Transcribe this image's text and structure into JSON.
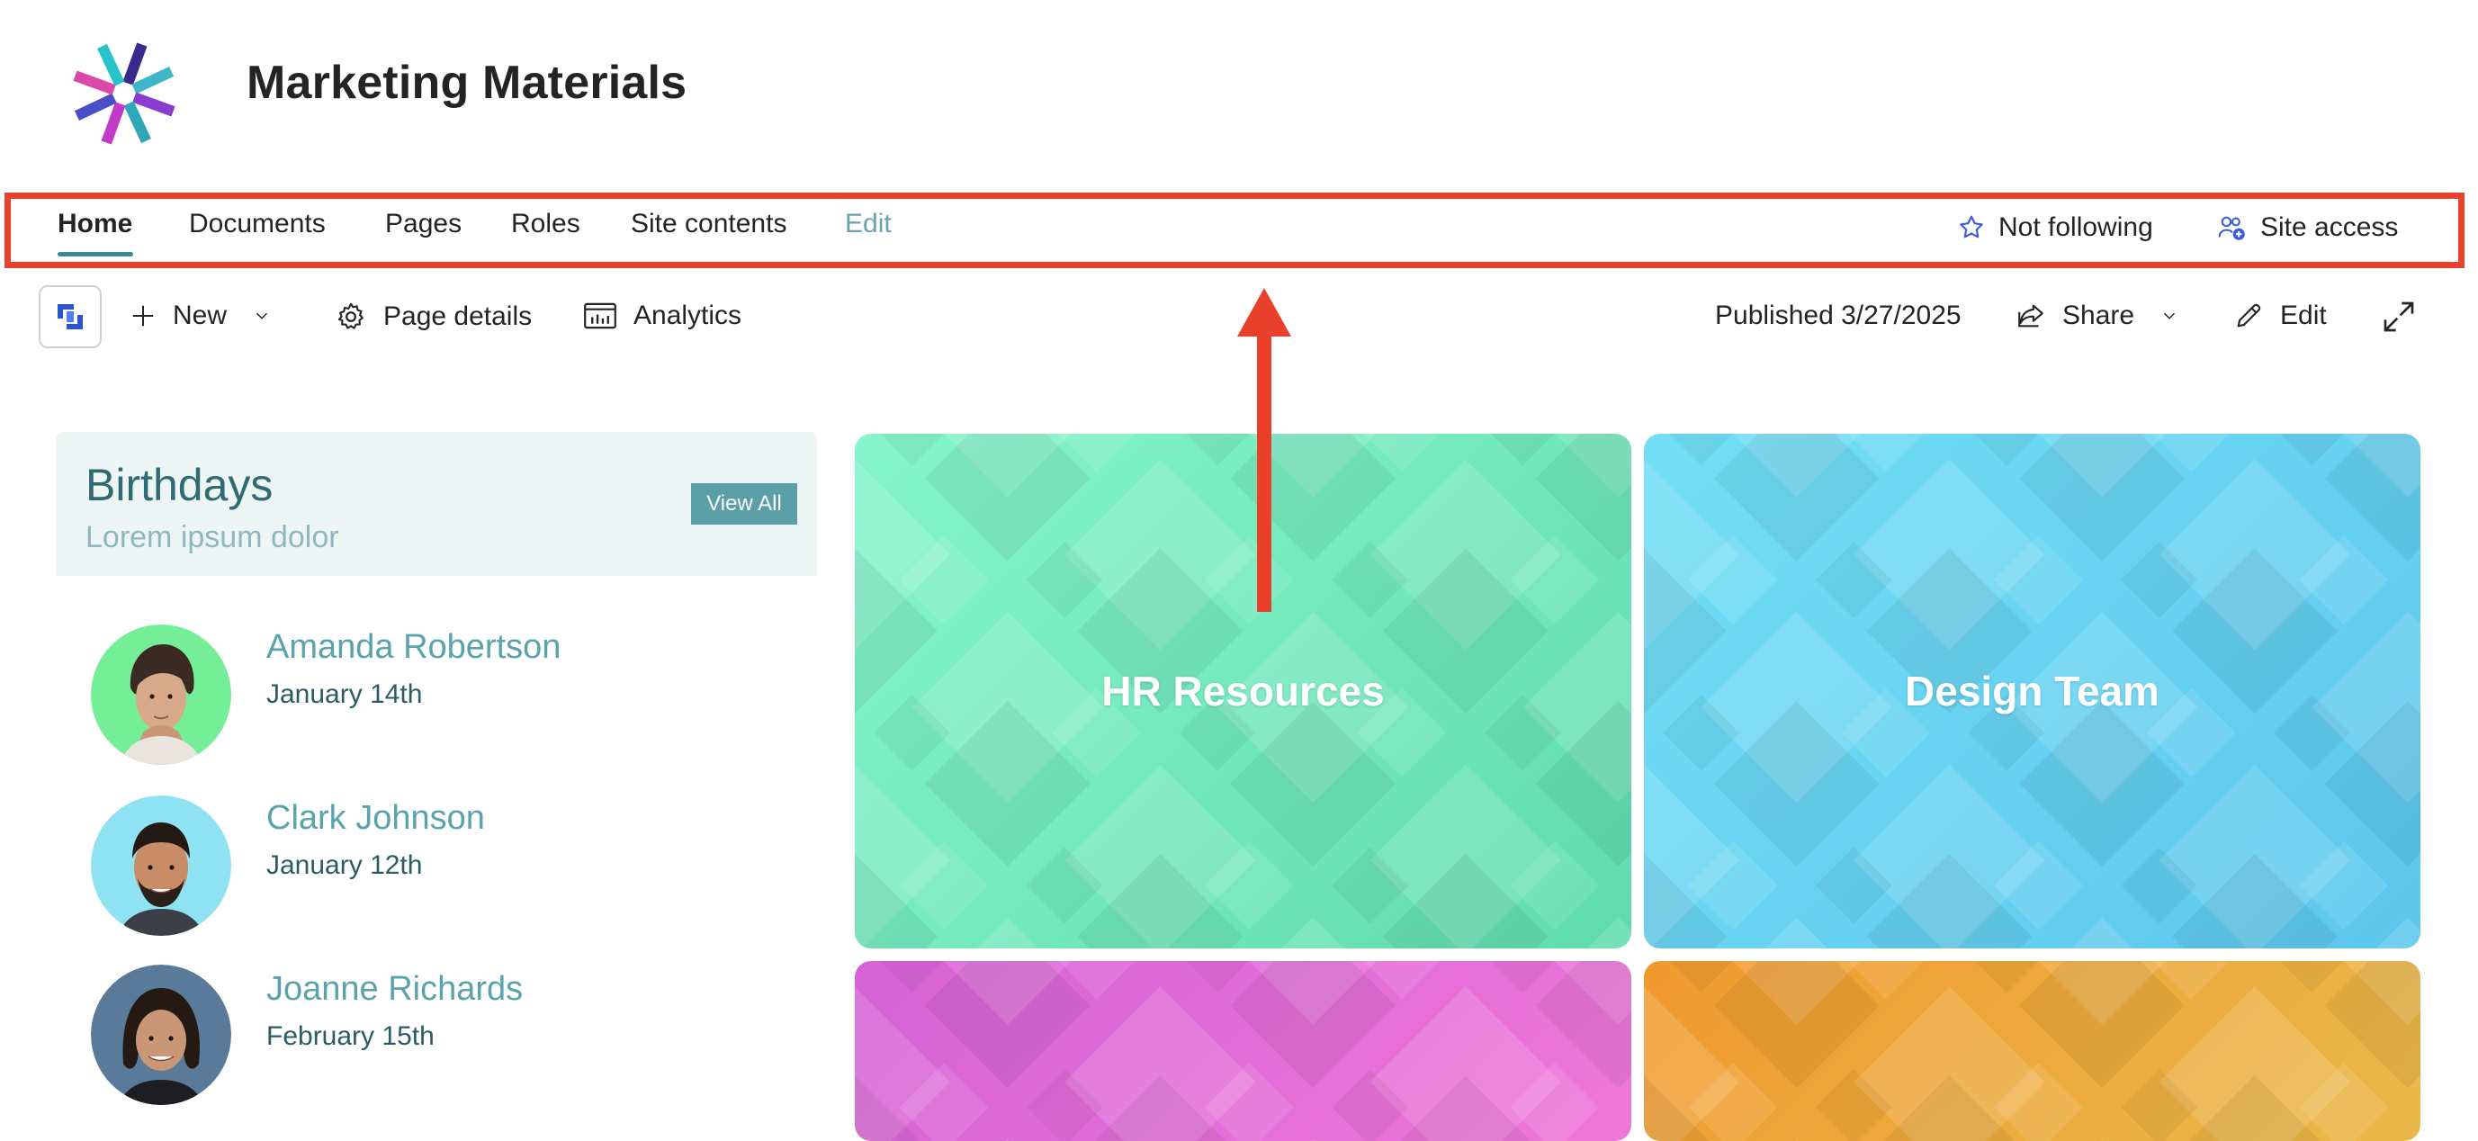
{
  "site": {
    "title": "Marketing Materials"
  },
  "nav": {
    "items": [
      {
        "label": "Home"
      },
      {
        "label": "Documents"
      },
      {
        "label": "Pages"
      },
      {
        "label": "Roles"
      },
      {
        "label": "Site contents"
      },
      {
        "label": "Edit"
      }
    ],
    "follow_label": "Not following",
    "site_access_label": "Site access"
  },
  "commandbar": {
    "new_label": "New",
    "page_details_label": "Page details",
    "analytics_label": "Analytics",
    "published": "Published 3/27/2025",
    "share_label": "Share",
    "edit_label": "Edit"
  },
  "birthdays": {
    "title": "Birthdays",
    "subtitle": "Lorem ipsum dolor",
    "view_all_label": "View All",
    "people": [
      {
        "name": "Amanda Robertson",
        "date": "January 14th"
      },
      {
        "name": "Clark Johnson",
        "date": "January 12th"
      },
      {
        "name": "Joanne Richards",
        "date": "February 15th"
      }
    ]
  },
  "tiles": [
    {
      "label": "HR Resources"
    },
    {
      "label": "Design Team"
    },
    {
      "label": ""
    },
    {
      "label": ""
    }
  ],
  "colors": {
    "annotation_red": "#e8402a",
    "accent_teal": "#3b8a92",
    "tile_green": "#6fe6b8",
    "tile_cyan": "#6ad9f0",
    "tile_magenta": "#e56ad8",
    "tile_orange": "#eea53a"
  }
}
